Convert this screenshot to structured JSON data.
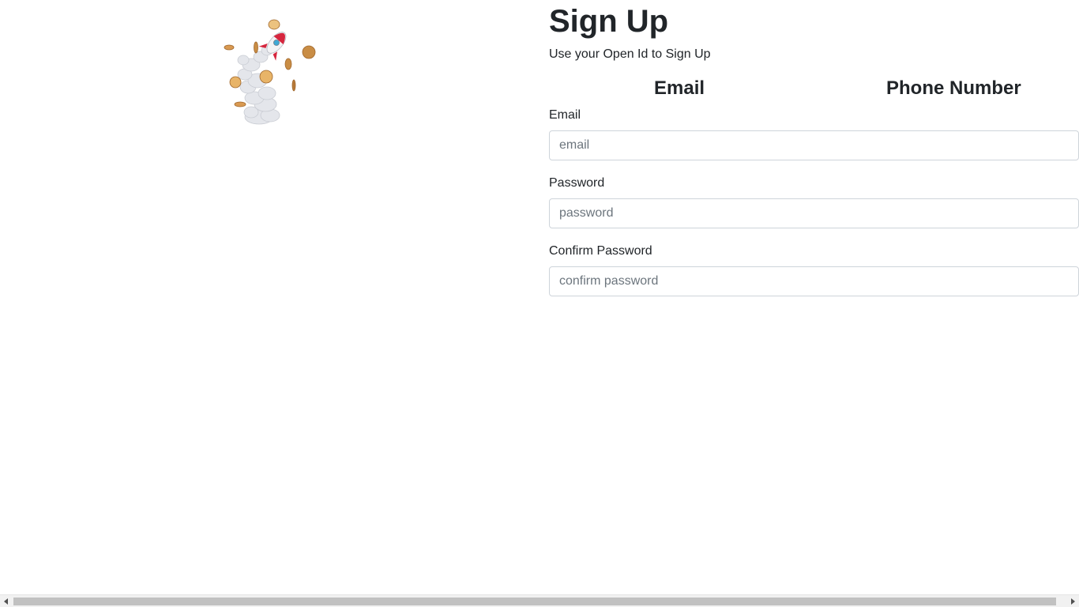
{
  "illustration": {
    "icon": "rocket-coins-illustration",
    "colors": {
      "rocket_red": "#d6263e",
      "coin_gold": "#e3a85a",
      "smoke": "#dfe1e6"
    }
  },
  "signup": {
    "title": "Sign Up",
    "subtitle": "Use your Open Id to Sign Up",
    "tabs": {
      "email": "Email",
      "phone": "Phone Number"
    },
    "fields": {
      "email": {
        "label": "Email",
        "placeholder": "email"
      },
      "password": {
        "label": "Password",
        "placeholder": "password"
      },
      "confirm_password": {
        "label": "Confirm Password",
        "placeholder": "confirm password"
      }
    }
  },
  "scrollbar": {
    "left_icon": "triangle-left-icon",
    "right_icon": "triangle-right-icon"
  }
}
